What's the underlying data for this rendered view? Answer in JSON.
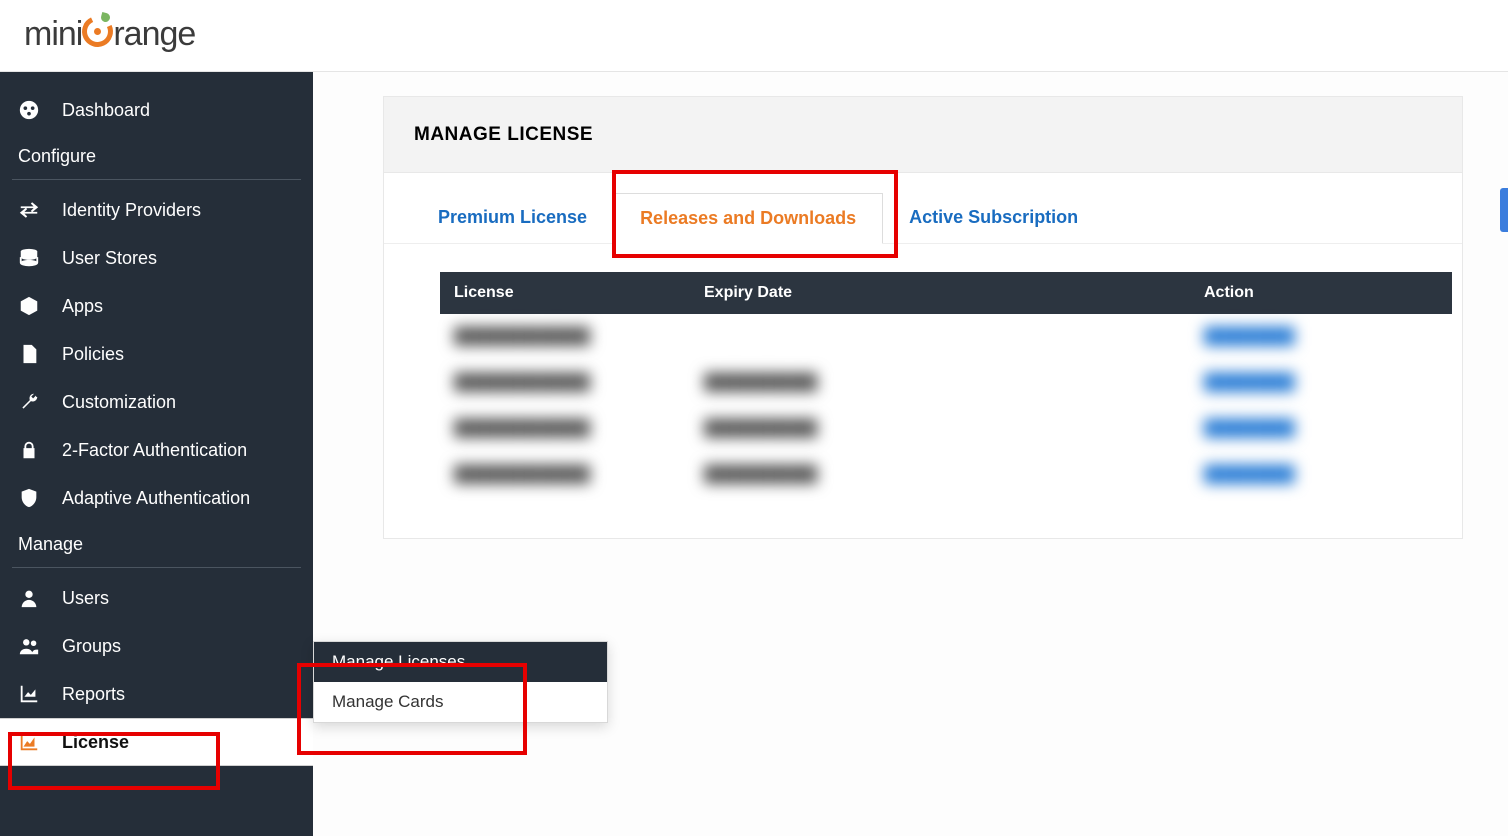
{
  "brand": {
    "mini": "mini",
    "range": "range"
  },
  "sidebar": {
    "items": [
      {
        "label": "Dashboard"
      }
    ],
    "group_configure": "Configure",
    "configure_items": [
      {
        "label": "Identity Providers"
      },
      {
        "label": "User Stores"
      },
      {
        "label": "Apps"
      },
      {
        "label": "Policies"
      },
      {
        "label": "Customization"
      },
      {
        "label": "2-Factor Authentication"
      },
      {
        "label": "Adaptive Authentication"
      }
    ],
    "group_manage": "Manage",
    "manage_items": [
      {
        "label": "Users"
      },
      {
        "label": "Groups"
      },
      {
        "label": "Reports"
      },
      {
        "label": "License"
      }
    ]
  },
  "flyout": {
    "items": [
      {
        "label": "Manage Licenses"
      },
      {
        "label": "Manage Cards"
      }
    ]
  },
  "page": {
    "title": "MANAGE LICENSE",
    "tabs": [
      {
        "label": "Premium License"
      },
      {
        "label": "Releases and Downloads"
      },
      {
        "label": "Active Subscription"
      }
    ],
    "columns": {
      "c1": "License",
      "c2": "Expiry Date",
      "c3": "Action"
    },
    "rows": [
      {
        "license": "████████████",
        "expiry": "",
        "action": "████████"
      },
      {
        "license": "████████████",
        "expiry": "██████████",
        "action": "████████"
      },
      {
        "license": "████████████",
        "expiry": "██████████",
        "action": "████████"
      },
      {
        "license": "████████████",
        "expiry": "██████████",
        "action": "████████"
      }
    ]
  }
}
